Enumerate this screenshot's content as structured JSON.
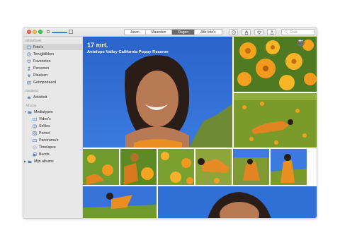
{
  "toolbar": {
    "tabs": [
      {
        "label": "Jaren"
      },
      {
        "label": "Maanden"
      },
      {
        "label": "Dagen",
        "active": true
      },
      {
        "label": "Alle foto's"
      }
    ],
    "info_icon": "info-icon",
    "share_icon": "share-icon",
    "favorite_icon": "heart-icon",
    "export_icon": "upload-icon",
    "search": {
      "placeholder": "Zoek"
    }
  },
  "sidebar": {
    "sections": [
      {
        "title": "Bibliotheek"
      },
      {
        "title": "Gedeeld"
      },
      {
        "title": "Albums"
      }
    ],
    "library_items": [
      {
        "label": "Foto's",
        "icon": "photos-icon",
        "selected": true
      },
      {
        "label": "Terugblikken",
        "icon": "memories-icon"
      },
      {
        "label": "Favorieten",
        "icon": "heart-icon"
      },
      {
        "label": "Personen",
        "icon": "person-icon"
      },
      {
        "label": "Plaatsen",
        "icon": "pin-icon"
      },
      {
        "label": "Geïmporteerd",
        "icon": "import-icon"
      }
    ],
    "shared_items": [
      {
        "label": "Activiteit",
        "icon": "cloud-icon"
      }
    ],
    "album_items": [
      {
        "label": "Mediatypen",
        "icon": "folder-icon"
      },
      {
        "label": "Video's",
        "icon": "video-icon"
      },
      {
        "label": "Selfies",
        "icon": "selfie-icon"
      },
      {
        "label": "Portret",
        "icon": "portrait-icon"
      },
      {
        "label": "Panorama's",
        "icon": "panorama-icon"
      },
      {
        "label": "Timelapse",
        "icon": "timelapse-icon"
      },
      {
        "label": "Bursts",
        "icon": "burst-icon"
      },
      {
        "label": "Mijn albums",
        "icon": "folder-icon"
      }
    ]
  },
  "hero": {
    "date": "17 mrt.",
    "location": "Antelope Valley California Poppy Reserve",
    "more_label": "•••"
  },
  "colors": {
    "accent": "#3a7ee8",
    "sky_blue": "#2f6fd6",
    "poppy_orange": "#f29a1e",
    "meadow_green": "#7a9a2a"
  }
}
